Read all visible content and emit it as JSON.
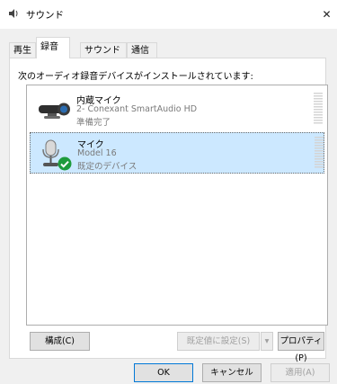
{
  "window": {
    "title": "サウンド",
    "close_glyph": "✕"
  },
  "tabs": [
    {
      "label": "再生"
    },
    {
      "label": "録音"
    },
    {
      "label": "サウンド"
    },
    {
      "label": "通信"
    }
  ],
  "active_tab": "録音",
  "instruction": "次のオーディオ録音デバイスがインストールされています:",
  "devices": [
    {
      "name": "内蔵マイク",
      "description": "2- Conexant SmartAudio HD",
      "status": "準備完了",
      "icon": "webcam-mic-icon",
      "selected": false
    },
    {
      "name": "マイク",
      "description": "Model 16",
      "status": "既定のデバイス",
      "icon": "microphone-icon",
      "badge": "default-check-icon",
      "selected": true
    }
  ],
  "buttons": {
    "configure": "構成(C)",
    "set_default": "既定値に設定(S)",
    "set_default_dropdown": "▾",
    "properties": "プロパティ(P)",
    "ok": "OK",
    "cancel": "キャンセル",
    "apply": "適用(A)"
  },
  "colors": {
    "selection": "#cce8ff",
    "check_badge": "#1e9b3c",
    "default_button_border": "#0078d7"
  }
}
